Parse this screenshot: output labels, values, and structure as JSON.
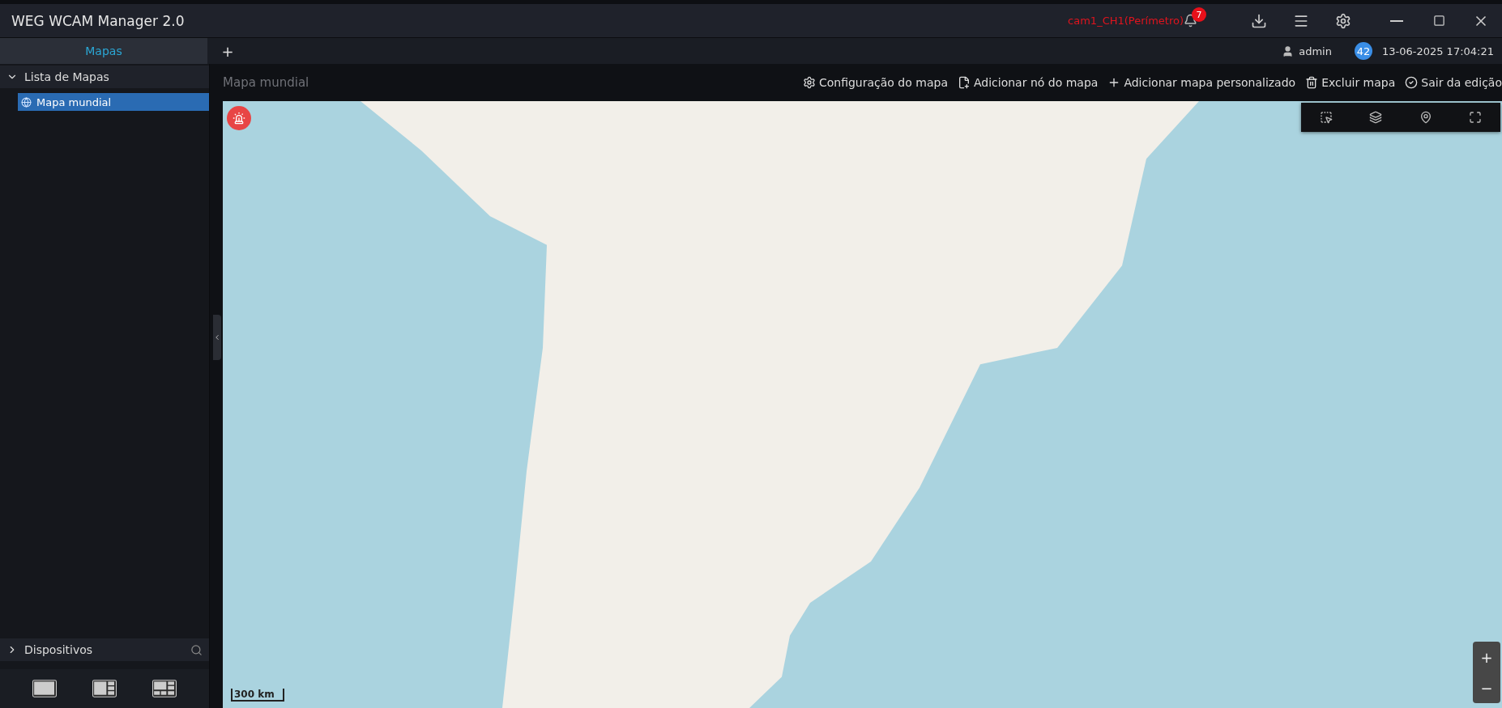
{
  "window": {
    "title": "WEG WCAM Manager 2.0"
  },
  "alarm": {
    "text": "cam1_CH1(Perímetro)",
    "count": "7"
  },
  "tabs": [
    {
      "label": "Mapas",
      "selected": true
    }
  ],
  "add_tab": "+",
  "user": {
    "name": "admin"
  },
  "badge": "42",
  "datetime": "13-06-2025 17:04:21",
  "sidebar": {
    "map_list": {
      "title": "Lista de Mapas",
      "expanded": true,
      "items": [
        {
          "label": "Mapa mundial",
          "selected": true
        }
      ]
    },
    "devices": {
      "title": "Dispositivos",
      "expanded": false
    },
    "layouts": [
      {
        "kind": "single"
      },
      {
        "kind": "split3"
      },
      {
        "kind": "split6"
      }
    ]
  },
  "map": {
    "title": "Mapa mundial",
    "actions": [
      {
        "kind": "settings",
        "label": "Configuração do mapa"
      },
      {
        "kind": "add-node",
        "label": "Adicionar nó do mapa"
      },
      {
        "kind": "add",
        "label": "Adicionar mapa personalizado"
      },
      {
        "kind": "delete",
        "label": "Excluir mapa"
      },
      {
        "kind": "exit",
        "label": "Sair da edição"
      }
    ],
    "scale": "300 km",
    "zoom": [
      "+",
      "−"
    ]
  }
}
